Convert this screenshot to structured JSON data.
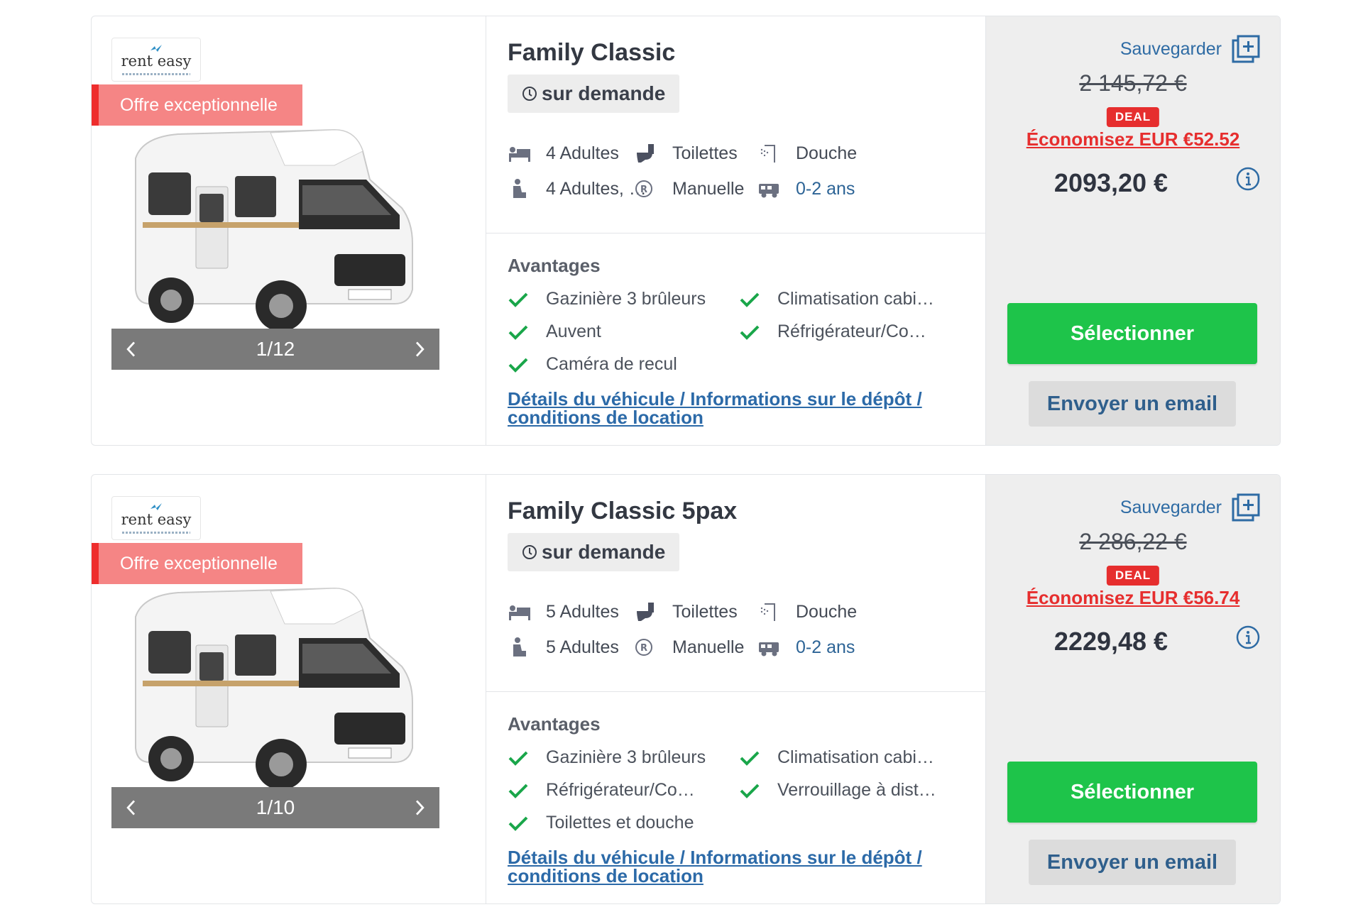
{
  "colors": {
    "accent_green": "#1ec44a",
    "deal_red": "#e62e2e",
    "ribbon": "#f58585",
    "link_blue": "#2c6aa8"
  },
  "listings": [
    {
      "brand": {
        "name": "rent easy"
      },
      "ribbon": "Offre exceptionnelle",
      "carousel": {
        "counter": "1/12",
        "current": 1,
        "total": 12
      },
      "title": "Family Classic",
      "availability": "sur demande",
      "features": {
        "sleeps": "4 Adultes",
        "toilet": "Toilettes",
        "shower": "Douche",
        "seats": "4 Adultes, …",
        "transmission": "Manuelle",
        "age": "0-2 ans"
      },
      "advantages_title": "Avantages",
      "advantages": [
        "Gazinière 3 brûleurs",
        "Climatisation cabi…",
        "Auvent",
        "Réfrigérateur/Co…",
        "Caméra de recul"
      ],
      "details_link": "Détails du véhicule / Informations sur le dépôt / conditions de location",
      "save_label": "Sauvegarder",
      "old_price": "2 145,72 €",
      "deal_badge": "DEAL",
      "savings": "Économisez EUR €52.52",
      "price": "2093,20 €",
      "select_label": "Sélectionner",
      "email_label": "Envoyer un email"
    },
    {
      "brand": {
        "name": "rent easy"
      },
      "ribbon": "Offre exceptionnelle",
      "carousel": {
        "counter": "1/10",
        "current": 1,
        "total": 10
      },
      "title": "Family Classic 5pax",
      "availability": "sur demande",
      "features": {
        "sleeps": "5 Adultes",
        "toilet": "Toilettes",
        "shower": "Douche",
        "seats": "5 Adultes",
        "transmission": "Manuelle",
        "age": "0-2 ans"
      },
      "advantages_title": "Avantages",
      "advantages": [
        "Gazinière 3 brûleurs",
        "Climatisation cabi…",
        "Réfrigérateur/Co…",
        "Verrouillage à dist…",
        "Toilettes et douche"
      ],
      "details_link": "Détails du véhicule / Informations sur le dépôt / conditions de location",
      "save_label": "Sauvegarder",
      "old_price": "2 286,22 €",
      "deal_badge": "DEAL",
      "savings": "Économisez EUR €56.74",
      "price": "2229,48 €",
      "select_label": "Sélectionner",
      "email_label": "Envoyer un email"
    }
  ]
}
